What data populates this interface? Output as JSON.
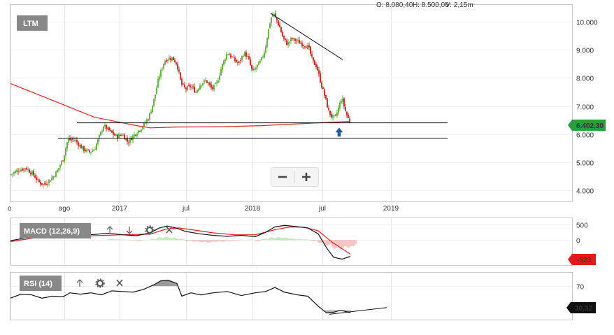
{
  "ohlc_header": {
    "open": "O: 8.080,40",
    "high": "H: 8.500,00",
    "volume": "V: 2,15m"
  },
  "chart_data": [
    {
      "type": "candlestick",
      "title": "LTM",
      "x_ticks": [
        "o",
        "ago",
        "2017",
        "jul",
        "2018",
        "jul",
        "2019"
      ],
      "y_ticks": [
        "4.000",
        "5.000",
        "6.000",
        "7.000",
        "8.000",
        "9.000",
        "10.000"
      ],
      "ylim": [
        3600,
        10600
      ],
      "last_price": "6.402,30",
      "up_color": "#6ab04c",
      "down_color": "#c0392b",
      "close_path": [
        [
          0,
          4550
        ],
        [
          10,
          4700
        ],
        [
          22,
          4800
        ],
        [
          33,
          4550
        ],
        [
          40,
          4300
        ],
        [
          48,
          4200
        ],
        [
          58,
          4400
        ],
        [
          66,
          4650
        ],
        [
          75,
          5100
        ],
        [
          82,
          5800
        ],
        [
          92,
          5800
        ],
        [
          102,
          5500
        ],
        [
          112,
          5350
        ],
        [
          120,
          5450
        ],
        [
          127,
          5900
        ],
        [
          133,
          6300
        ],
        [
          142,
          6100
        ],
        [
          152,
          5900
        ],
        [
          160,
          6000
        ],
        [
          168,
          5700
        ],
        [
          174,
          5900
        ],
        [
          182,
          6100
        ],
        [
          190,
          6300
        ],
        [
          198,
          6600
        ],
        [
          206,
          7300
        ],
        [
          212,
          8000
        ],
        [
          220,
          8600
        ],
        [
          226,
          8700
        ],
        [
          232,
          8700
        ],
        [
          238,
          8500
        ],
        [
          244,
          7800
        ],
        [
          250,
          7600
        ],
        [
          258,
          7700
        ],
        [
          265,
          7500
        ],
        [
          272,
          7800
        ],
        [
          280,
          7900
        ],
        [
          288,
          7600
        ],
        [
          295,
          7800
        ],
        [
          302,
          8400
        ],
        [
          310,
          8900
        ],
        [
          318,
          8700
        ],
        [
          326,
          8500
        ],
        [
          334,
          8900
        ],
        [
          340,
          8700
        ],
        [
          346,
          8200
        ],
        [
          352,
          8400
        ],
        [
          358,
          8600
        ],
        [
          364,
          9000
        ],
        [
          368,
          9600
        ],
        [
          372,
          10100
        ],
        [
          376,
          10300
        ],
        [
          380,
          10100
        ],
        [
          385,
          9800
        ],
        [
          390,
          9400
        ],
        [
          396,
          9200
        ],
        [
          402,
          9400
        ],
        [
          410,
          9300
        ],
        [
          418,
          9200
        ],
        [
          426,
          9100
        ],
        [
          432,
          8600
        ],
        [
          438,
          8400
        ],
        [
          444,
          7800
        ],
        [
          450,
          7300
        ],
        [
          455,
          6800
        ],
        [
          460,
          6600
        ],
        [
          465,
          6600
        ],
        [
          470,
          7000
        ],
        [
          474,
          7300
        ],
        [
          478,
          6900
        ],
        [
          482,
          6600
        ],
        [
          486,
          6402
        ]
      ],
      "ma_series": {
        "color": "#e02020",
        "values": [
          [
            0,
            7800
          ],
          [
            30,
            7500
          ],
          [
            60,
            7200
          ],
          [
            90,
            6900
          ],
          [
            120,
            6600
          ],
          [
            150,
            6450
          ],
          [
            180,
            6300
          ],
          [
            200,
            6220
          ],
          [
            240,
            6250
          ],
          [
            300,
            6260
          ],
          [
            360,
            6300
          ],
          [
            400,
            6350
          ],
          [
            440,
            6400
          ],
          [
            486,
            6450
          ]
        ]
      },
      "support_lines": [
        {
          "from": [
            95,
            6400
          ],
          "to": [
            625,
            6400
          ]
        },
        {
          "from": [
            68,
            5850
          ],
          "to": [
            625,
            5850
          ]
        }
      ],
      "trend_line": {
        "from": [
          372,
          10300
        ],
        "to": [
          475,
          8650
        ]
      }
    },
    {
      "type": "line",
      "title": "MACD (12,26,9)",
      "y_ticks": [
        "500",
        "0"
      ],
      "ylim": [
        -800,
        700
      ],
      "last_value": "-523",
      "macd": [
        [
          0,
          -20
        ],
        [
          20,
          60
        ],
        [
          40,
          120
        ],
        [
          60,
          90
        ],
        [
          80,
          130
        ],
        [
          100,
          160
        ],
        [
          120,
          180
        ],
        [
          140,
          220
        ],
        [
          160,
          170
        ],
        [
          180,
          140
        ],
        [
          200,
          230
        ],
        [
          212,
          380
        ],
        [
          224,
          450
        ],
        [
          236,
          390
        ],
        [
          250,
          280
        ],
        [
          270,
          200
        ],
        [
          290,
          150
        ],
        [
          310,
          120
        ],
        [
          330,
          150
        ],
        [
          350,
          110
        ],
        [
          365,
          250
        ],
        [
          378,
          420
        ],
        [
          392,
          470
        ],
        [
          410,
          430
        ],
        [
          425,
          390
        ],
        [
          440,
          200
        ],
        [
          452,
          -250
        ],
        [
          462,
          -550
        ],
        [
          474,
          -610
        ],
        [
          486,
          -523
        ]
      ],
      "signal": [
        [
          0,
          -50
        ],
        [
          40,
          90
        ],
        [
          80,
          110
        ],
        [
          120,
          140
        ],
        [
          160,
          170
        ],
        [
          200,
          190
        ],
        [
          222,
          350
        ],
        [
          240,
          390
        ],
        [
          260,
          330
        ],
        [
          290,
          230
        ],
        [
          320,
          170
        ],
        [
          350,
          170
        ],
        [
          380,
          340
        ],
        [
          400,
          420
        ],
        [
          420,
          410
        ],
        [
          440,
          300
        ],
        [
          460,
          -70
        ],
        [
          486,
          -450
        ]
      ],
      "histogram": [
        [
          140,
          40
        ],
        [
          150,
          25
        ],
        [
          160,
          15
        ],
        [
          170,
          -10
        ],
        [
          180,
          -30
        ],
        [
          190,
          10
        ],
        [
          200,
          40
        ],
        [
          210,
          90
        ],
        [
          220,
          110
        ],
        [
          230,
          80
        ],
        [
          240,
          40
        ],
        [
          250,
          -30
        ],
        [
          260,
          -50
        ],
        [
          270,
          -70
        ],
        [
          280,
          -80
        ],
        [
          290,
          -60
        ],
        [
          300,
          -50
        ],
        [
          310,
          -30
        ],
        [
          320,
          -20
        ],
        [
          330,
          10
        ],
        [
          340,
          20
        ],
        [
          350,
          -30
        ],
        [
          360,
          40
        ],
        [
          370,
          90
        ],
        [
          380,
          100
        ],
        [
          390,
          80
        ],
        [
          400,
          50
        ],
        [
          410,
          30
        ],
        [
          420,
          20
        ],
        [
          430,
          -30
        ],
        [
          440,
          -90
        ],
        [
          450,
          -180
        ],
        [
          460,
          -280
        ],
        [
          470,
          -300
        ],
        [
          480,
          -250
        ],
        [
          486,
          -200
        ]
      ]
    },
    {
      "type": "line",
      "title": "RSI (14)",
      "y_ticks": [
        "70"
      ],
      "ylim": [
        20,
        90
      ],
      "last_value": "30,32",
      "rsi": [
        [
          0,
          52
        ],
        [
          15,
          58
        ],
        [
          30,
          57
        ],
        [
          45,
          52
        ],
        [
          60,
          55
        ],
        [
          75,
          54
        ],
        [
          85,
          60
        ],
        [
          100,
          58
        ],
        [
          115,
          60
        ],
        [
          130,
          57
        ],
        [
          145,
          63
        ],
        [
          160,
          62
        ],
        [
          175,
          61
        ],
        [
          190,
          65
        ],
        [
          205,
          72
        ],
        [
          215,
          78
        ],
        [
          225,
          79
        ],
        [
          238,
          74
        ],
        [
          245,
          55
        ],
        [
          258,
          60
        ],
        [
          272,
          57
        ],
        [
          290,
          60
        ],
        [
          310,
          62
        ],
        [
          330,
          56
        ],
        [
          350,
          60
        ],
        [
          365,
          62
        ],
        [
          378,
          68
        ],
        [
          392,
          61
        ],
        [
          410,
          57
        ],
        [
          425,
          55
        ],
        [
          440,
          40
        ],
        [
          452,
          30
        ],
        [
          462,
          31
        ],
        [
          472,
          34
        ],
        [
          486,
          30.3
        ]
      ],
      "trend_line": {
        "from": [
          456,
          28
        ],
        "to": [
          538,
          38
        ]
      }
    }
  ]
}
